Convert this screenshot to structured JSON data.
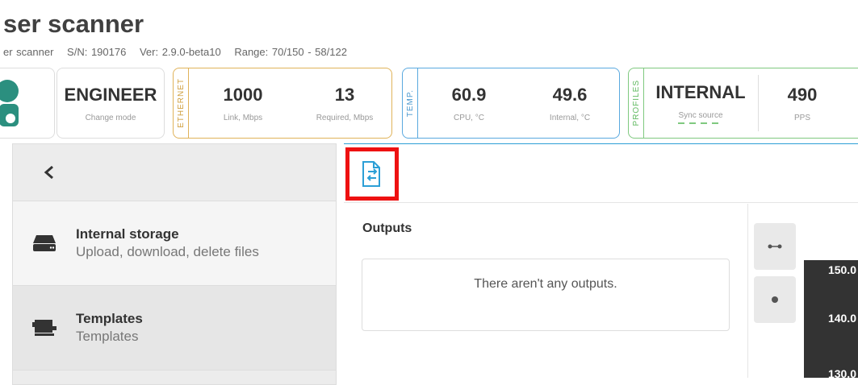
{
  "header": {
    "title": "ser scanner",
    "model": "er scanner",
    "serial": "S/N: 190176",
    "version": "Ver: 2.9.0-beta10",
    "range": "Range: 70/150 - 58/122"
  },
  "status": {
    "mode": {
      "value": "ENGINEER",
      "label": "Change mode"
    },
    "ethernet": {
      "tag": "ETHERNET",
      "link_value": "1000",
      "link_label": "Link, Mbps",
      "required_value": "13",
      "required_label": "Required, Mbps"
    },
    "temp": {
      "tag": "TEMP.",
      "cpu_value": "60.9",
      "cpu_label": "CPU, °C",
      "internal_value": "49.6",
      "internal_label": "Internal, °C"
    },
    "profiles": {
      "tag": "PROFILES",
      "sync_value": "INTERNAL",
      "sync_label": "Sync source",
      "pps_value": "490",
      "pps_label": "PPS"
    }
  },
  "sidebar": {
    "back_icon": "chevron-left-icon",
    "items": [
      {
        "title": "Internal storage",
        "subtitle": "Upload, download, delete files",
        "icon": "hard-drive-icon"
      },
      {
        "title": "Templates",
        "subtitle": "Templates",
        "icon": "templates-icon"
      }
    ]
  },
  "main": {
    "outputs_title": "Outputs",
    "outputs_empty": "There aren't any outputs.",
    "axis_ticks": [
      "150.0",
      "140.0",
      "130.0"
    ]
  },
  "colors": {
    "accent": "#2c9fd6",
    "ethernet": "#e0b35a",
    "temp": "#5aa9df",
    "profiles": "#7fc97f",
    "highlight": "#e11111"
  }
}
